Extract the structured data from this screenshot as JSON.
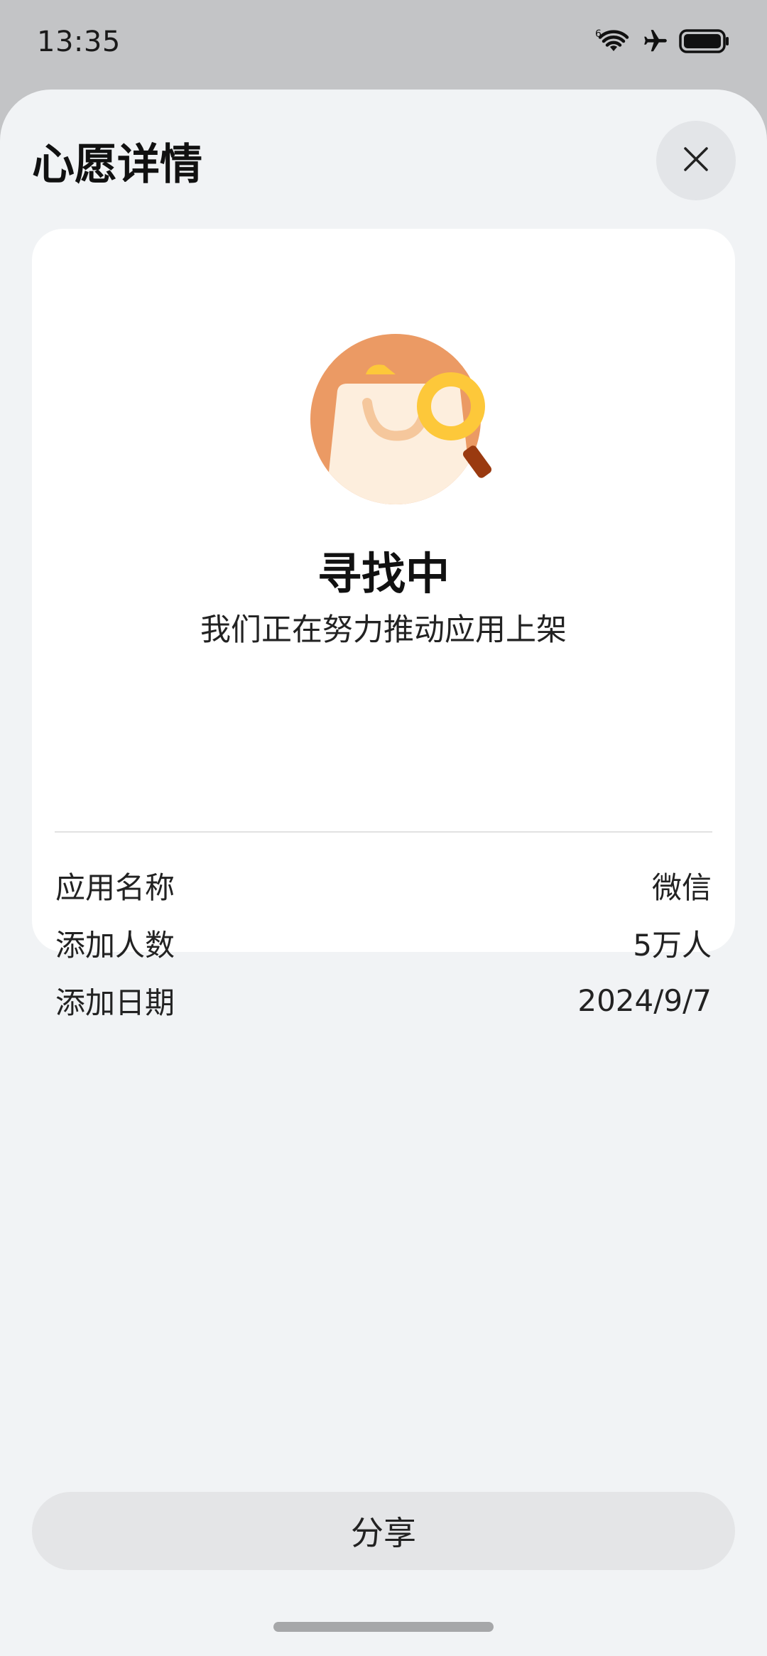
{
  "status_bar": {
    "time": "13:35",
    "icons": [
      "wifi-icon",
      "airplane-icon",
      "battery-icon"
    ],
    "wifi_badge": "6"
  },
  "sheet": {
    "title": "心愿详情",
    "close_icon": "close-icon"
  },
  "card": {
    "illustration_icon": "shopping-bag-search-icon",
    "status_heading": "寻找中",
    "status_description": "我们正在努力推动应用上架",
    "details": [
      {
        "label": "应用名称",
        "value": "微信"
      },
      {
        "label": "添加人数",
        "value": "5万人"
      },
      {
        "label": "添加日期",
        "value": "2024/9/7"
      }
    ]
  },
  "footer": {
    "share_label": "分享"
  },
  "colors": {
    "sheet_background": "#f1f3f5",
    "card_background": "#ffffff",
    "button_background": "#e4e5e7",
    "illustration_orange": "#eb9a64",
    "illustration_yellow": "#fdc83a",
    "illustration_handle": "#9a3a10"
  }
}
